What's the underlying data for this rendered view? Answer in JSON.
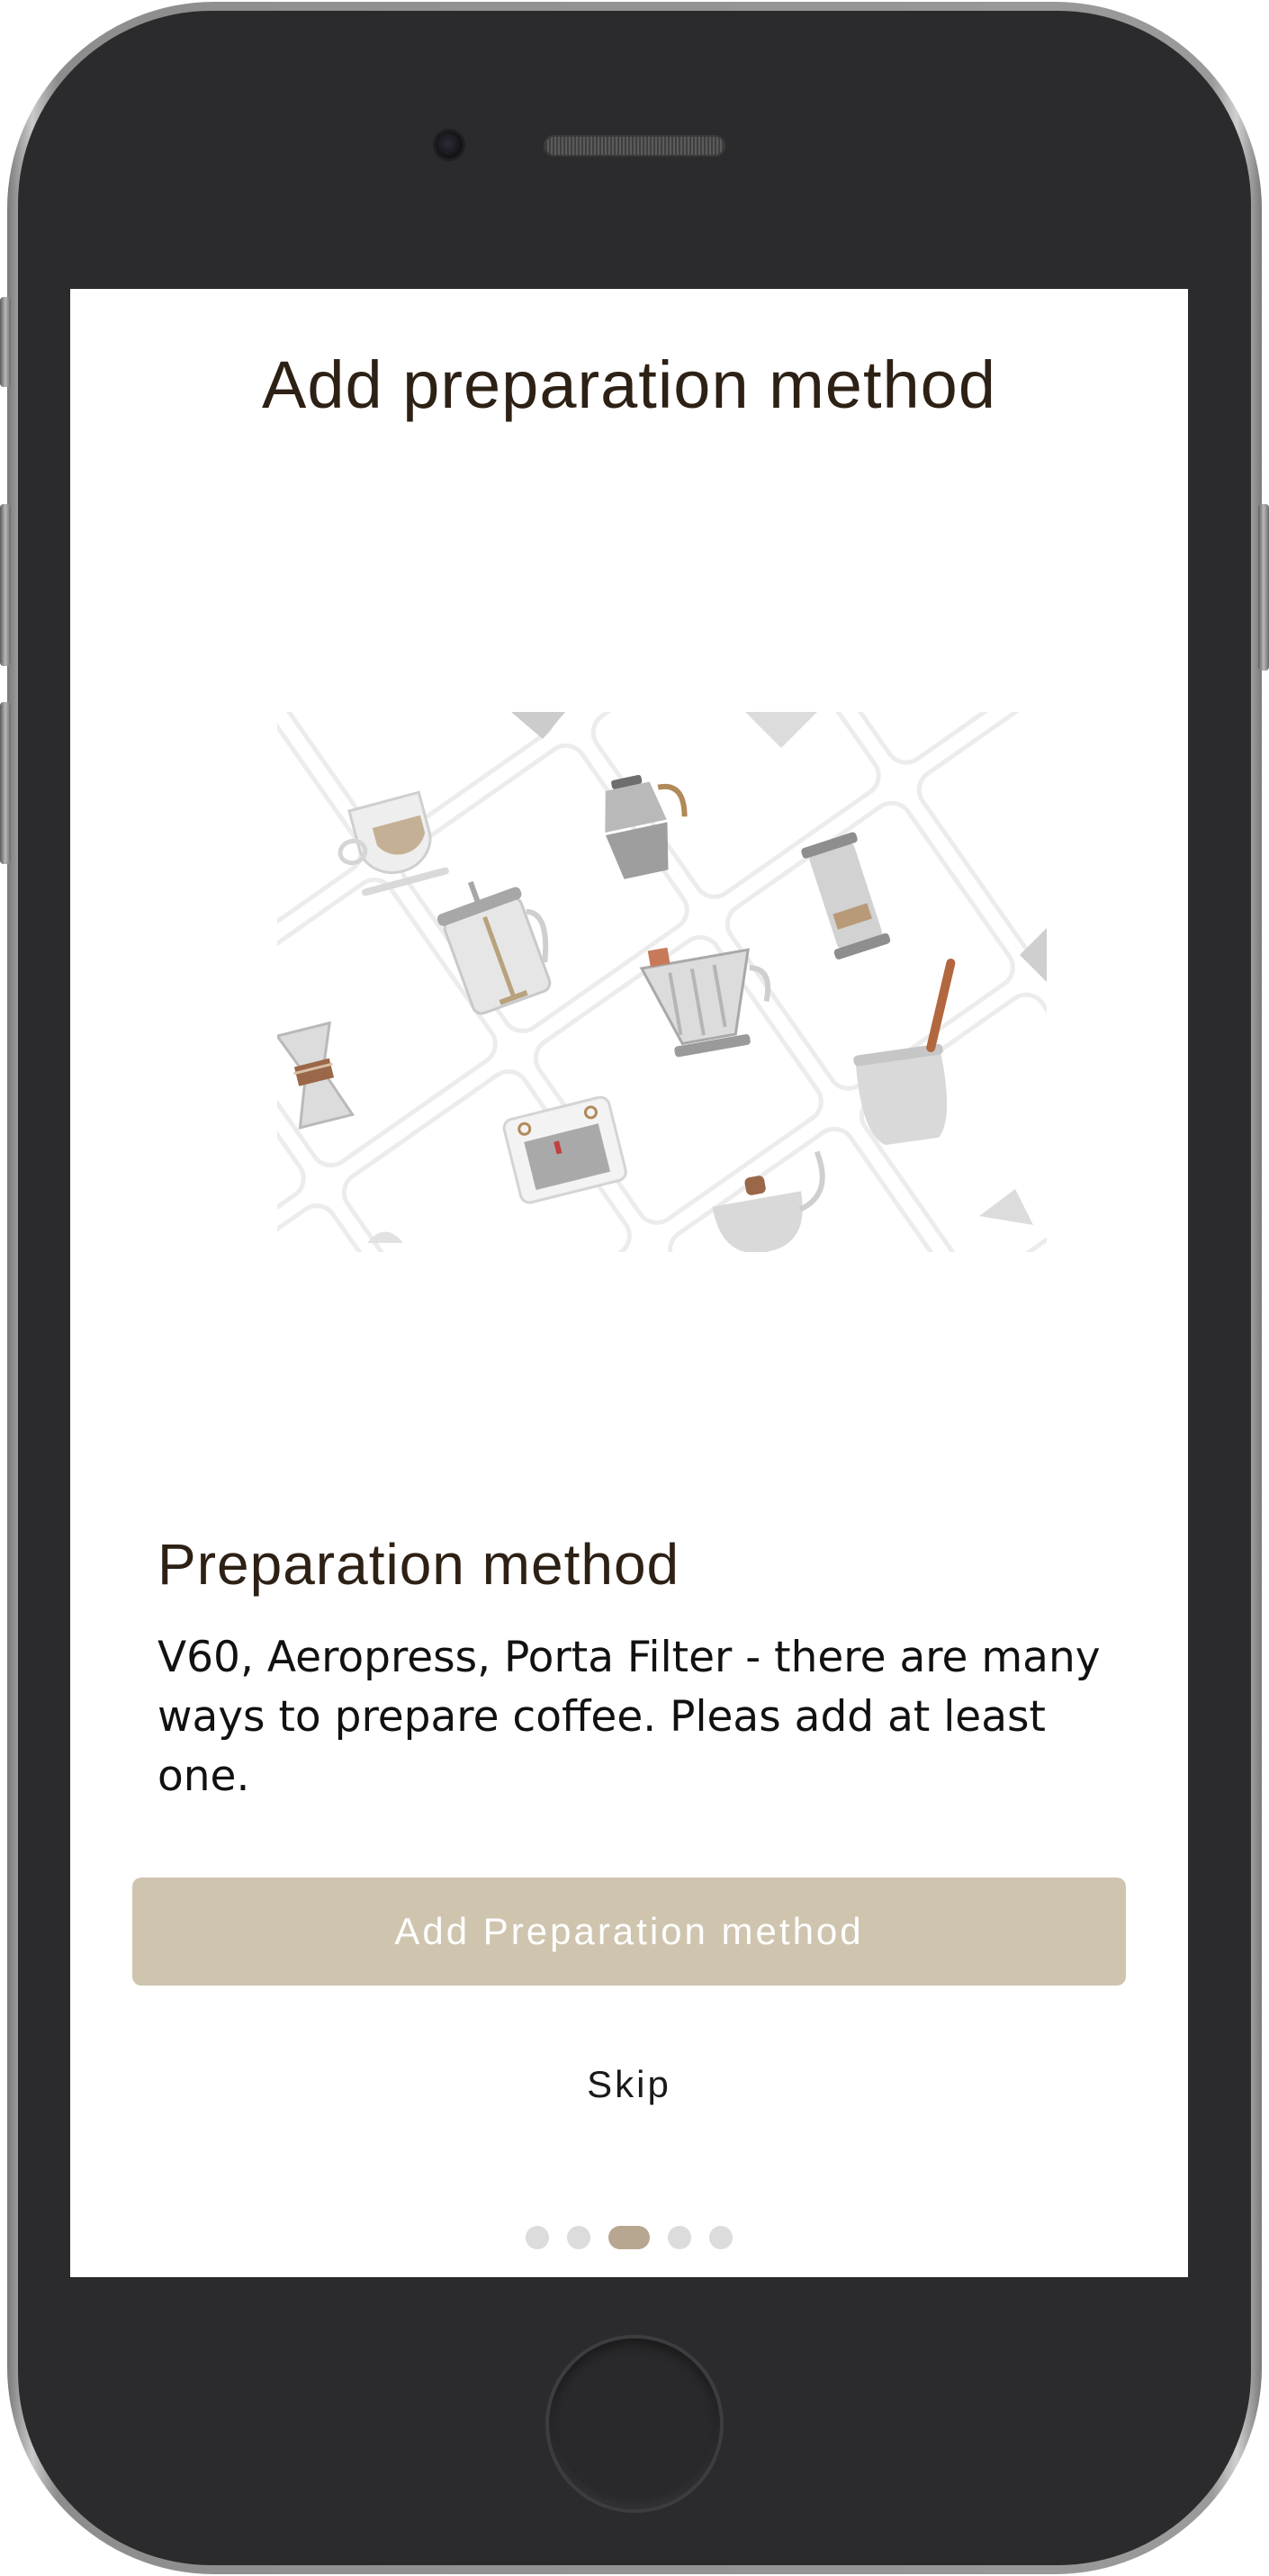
{
  "screen": {
    "title": "Add preparation method",
    "illustration": {
      "icons": [
        "cappuccino-cup-icon",
        "moka-pot-icon",
        "french-press-icon",
        "aeropress-icon",
        "v60-dripper-icon",
        "chemex-icon",
        "espresso-machine-icon",
        "gooseneck-kettle-icon",
        "turkish-cezve-icon"
      ]
    },
    "section": {
      "heading": "Preparation method",
      "body": "V60, Aeropress, Porta Filter - there are many ways to prepare coffee. Pleas add at least one."
    },
    "primary_button_label": "Add Preparation method",
    "skip_label": "Skip",
    "pager": {
      "total": 5,
      "active_index": 2
    }
  },
  "colors": {
    "accent": "#cfc5af",
    "active_dot": "#b7a790",
    "inactive_dot": "#dcdcdc",
    "title_text": "#2d2115",
    "device_body": "#2b2b2d"
  }
}
